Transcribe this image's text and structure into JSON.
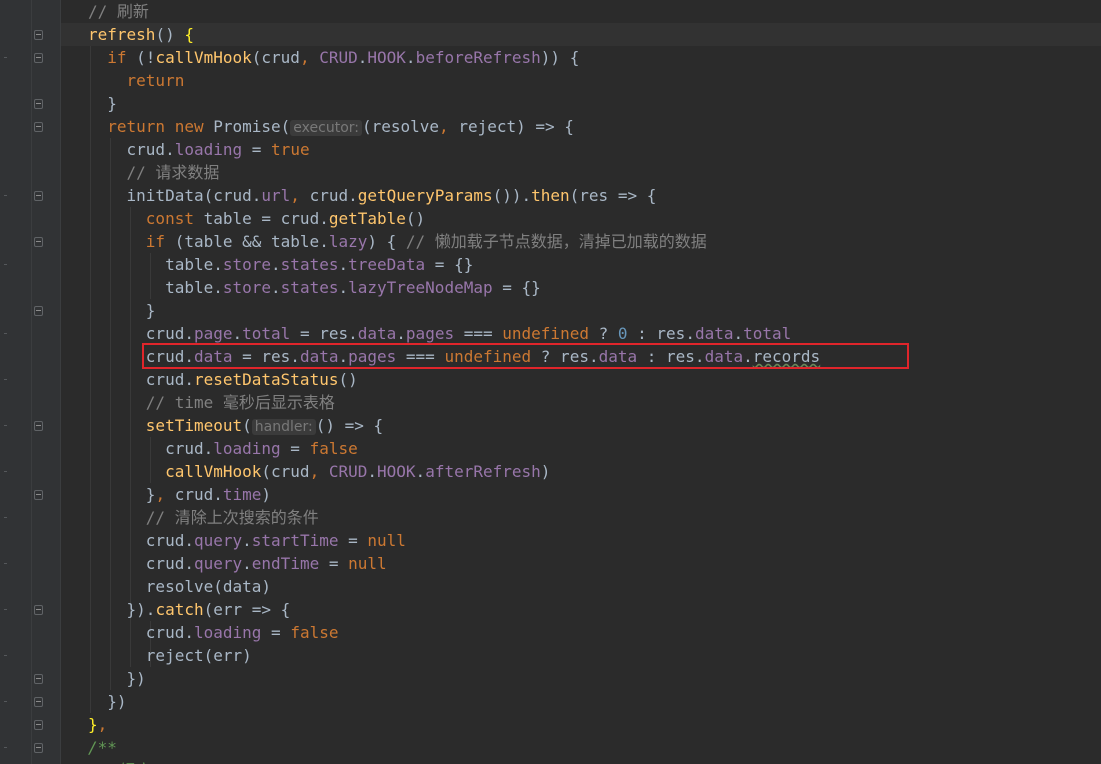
{
  "editor": {
    "theme": "darcula",
    "colors": {
      "background": "#2b2b2b",
      "gutter": "#313335",
      "keyword": "#cc7832",
      "function": "#ffc66d",
      "property": "#9876aa",
      "comment": "#808080",
      "number": "#6897bb",
      "highlight_box": "#e0252b"
    },
    "lines": [
      [
        [
          "cmt",
          "// 刷新"
        ]
      ],
      [
        [
          "fn",
          "refresh"
        ],
        [
          "t",
          "() "
        ],
        [
          "brace",
          "{"
        ]
      ],
      [
        [
          "t",
          "  "
        ],
        [
          "kw",
          "if"
        ],
        [
          "t",
          " (!"
        ],
        [
          "fn",
          "callVmHook"
        ],
        [
          "t",
          "(crud"
        ],
        [
          "kw",
          ","
        ],
        [
          "t",
          " "
        ],
        [
          "const",
          "CRUD"
        ],
        [
          "t",
          "."
        ],
        [
          "prop",
          "HOOK"
        ],
        [
          "t",
          "."
        ],
        [
          "prop",
          "beforeRefresh"
        ],
        [
          "t",
          ")) {"
        ]
      ],
      [
        [
          "t",
          "    "
        ],
        [
          "kw",
          "return"
        ]
      ],
      [
        [
          "t",
          "  }"
        ]
      ],
      [
        [
          "t",
          "  "
        ],
        [
          "kw",
          "return new "
        ],
        [
          "t",
          "Promise("
        ],
        [
          "hint",
          "executor:"
        ],
        [
          "t",
          "(resolve"
        ],
        [
          "kw",
          ","
        ],
        [
          "t",
          " reject) => {"
        ]
      ],
      [
        [
          "t",
          "    crud."
        ],
        [
          "prop",
          "loading"
        ],
        [
          "t",
          " = "
        ],
        [
          "kw",
          "true"
        ]
      ],
      [
        [
          "t",
          "    "
        ],
        [
          "cmt",
          "// 请求数据"
        ]
      ],
      [
        [
          "t",
          "    initData(crud."
        ],
        [
          "prop",
          "url"
        ],
        [
          "kw",
          ","
        ],
        [
          "t",
          " crud."
        ],
        [
          "fn",
          "getQueryParams"
        ],
        [
          "t",
          "())."
        ],
        [
          "fn",
          "then"
        ],
        [
          "t",
          "(res => {"
        ]
      ],
      [
        [
          "t",
          "      "
        ],
        [
          "kw",
          "const"
        ],
        [
          "t",
          " table = crud."
        ],
        [
          "fn",
          "getTable"
        ],
        [
          "t",
          "()"
        ]
      ],
      [
        [
          "t",
          "      "
        ],
        [
          "kw",
          "if"
        ],
        [
          "t",
          " (table && table."
        ],
        [
          "prop",
          "lazy"
        ],
        [
          "t",
          ") { "
        ],
        [
          "cmt",
          "// 懒加载子节点数据，清掉已加载的数据"
        ]
      ],
      [
        [
          "t",
          "        table."
        ],
        [
          "prop",
          "store"
        ],
        [
          "t",
          "."
        ],
        [
          "prop",
          "states"
        ],
        [
          "t",
          "."
        ],
        [
          "prop",
          "treeData"
        ],
        [
          "t",
          " = {}"
        ]
      ],
      [
        [
          "t",
          "        table."
        ],
        [
          "prop",
          "store"
        ],
        [
          "t",
          "."
        ],
        [
          "prop",
          "states"
        ],
        [
          "t",
          "."
        ],
        [
          "prop",
          "lazyTreeNodeMap"
        ],
        [
          "t",
          " = {}"
        ]
      ],
      [
        [
          "t",
          "      }"
        ]
      ],
      [
        [
          "t",
          "      crud."
        ],
        [
          "prop",
          "page"
        ],
        [
          "t",
          "."
        ],
        [
          "prop",
          "total"
        ],
        [
          "t",
          " = res."
        ],
        [
          "prop",
          "data"
        ],
        [
          "t",
          "."
        ],
        [
          "prop",
          "pages"
        ],
        [
          "t",
          " === "
        ],
        [
          "kw",
          "undefined"
        ],
        [
          "t",
          " ? "
        ],
        [
          "num",
          "0"
        ],
        [
          "t",
          " : res."
        ],
        [
          "prop",
          "data"
        ],
        [
          "t",
          "."
        ],
        [
          "prop",
          "total"
        ]
      ],
      [
        [
          "t",
          "      crud."
        ],
        [
          "prop",
          "data"
        ],
        [
          "t",
          " = res."
        ],
        [
          "prop",
          "data"
        ],
        [
          "t",
          "."
        ],
        [
          "prop",
          "pages"
        ],
        [
          "t",
          " === "
        ],
        [
          "kw",
          "undefined"
        ],
        [
          "t",
          " ? res."
        ],
        [
          "prop",
          "data"
        ],
        [
          "t",
          " : res."
        ],
        [
          "prop",
          "data"
        ],
        [
          "t",
          "."
        ],
        [
          "under",
          "records"
        ]
      ],
      [
        [
          "t",
          "      crud."
        ],
        [
          "fn",
          "resetDataStatus"
        ],
        [
          "t",
          "()"
        ]
      ],
      [
        [
          "t",
          "      "
        ],
        [
          "cmt",
          "// time 毫秒后显示表格"
        ]
      ],
      [
        [
          "t",
          "      "
        ],
        [
          "fn",
          "setTimeout"
        ],
        [
          "t",
          "("
        ],
        [
          "hint",
          "handler:"
        ],
        [
          "t",
          "() => {"
        ]
      ],
      [
        [
          "t",
          "        crud."
        ],
        [
          "prop",
          "loading"
        ],
        [
          "t",
          " = "
        ],
        [
          "kw",
          "false"
        ]
      ],
      [
        [
          "t",
          "        "
        ],
        [
          "fn",
          "callVmHook"
        ],
        [
          "t",
          "(crud"
        ],
        [
          "kw",
          ","
        ],
        [
          "t",
          " "
        ],
        [
          "const",
          "CRUD"
        ],
        [
          "t",
          "."
        ],
        [
          "prop",
          "HOOK"
        ],
        [
          "t",
          "."
        ],
        [
          "prop",
          "afterRefresh"
        ],
        [
          "t",
          ")"
        ]
      ],
      [
        [
          "t",
          "      }"
        ],
        [
          "kw",
          ","
        ],
        [
          "t",
          " crud."
        ],
        [
          "prop",
          "time"
        ],
        [
          "t",
          ")"
        ]
      ],
      [
        [
          "t",
          "      "
        ],
        [
          "cmt",
          "// 清除上次搜索的条件"
        ]
      ],
      [
        [
          "t",
          "      crud."
        ],
        [
          "prop",
          "query"
        ],
        [
          "t",
          "."
        ],
        [
          "prop",
          "startTime"
        ],
        [
          "t",
          " = "
        ],
        [
          "kw",
          "null"
        ]
      ],
      [
        [
          "t",
          "      crud."
        ],
        [
          "prop",
          "query"
        ],
        [
          "t",
          "."
        ],
        [
          "prop",
          "endTime"
        ],
        [
          "t",
          " = "
        ],
        [
          "kw",
          "null"
        ]
      ],
      [
        [
          "t",
          "      resolve(data)"
        ]
      ],
      [
        [
          "t",
          "    })."
        ],
        [
          "fn",
          "catch"
        ],
        [
          "t",
          "(err => {"
        ]
      ],
      [
        [
          "t",
          "      crud."
        ],
        [
          "prop",
          "loading"
        ],
        [
          "t",
          " = "
        ],
        [
          "kw",
          "false"
        ]
      ],
      [
        [
          "t",
          "      reject(err)"
        ]
      ],
      [
        [
          "t",
          "    })"
        ]
      ],
      [
        [
          "t",
          "  })"
        ]
      ],
      [
        [
          "brace",
          "}"
        ],
        [
          "kw",
          ","
        ]
      ],
      [
        [
          "doc",
          "/**"
        ]
      ],
      [
        [
          "doc",
          " * 提交"
        ]
      ]
    ]
  }
}
